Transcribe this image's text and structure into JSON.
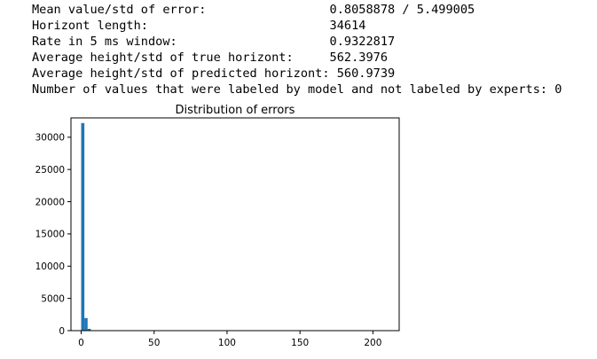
{
  "output_lines": [
    "Mean value/std of error:                 0.8058878 / 5.499005",
    "Horizont length:                         34614",
    "Rate in 5 ms window:                     0.9322817",
    "Average height/std of true horizont:     562.3976",
    "Average height/std of predicted horizont: 560.9739",
    "Number of values that were labeled by model and not labeled by experts: 0"
  ],
  "chart_data": {
    "type": "bar",
    "title": "Distribution of errors",
    "xlabel": "",
    "ylabel": "",
    "xlim": [
      -7,
      218
    ],
    "ylim": [
      0,
      33000
    ],
    "bar_width": 2.2,
    "bins": [
      {
        "x": 1.1,
        "value": 32200
      },
      {
        "x": 3.3,
        "value": 1950
      },
      {
        "x": 5.5,
        "value": 280
      },
      {
        "x": 7.7,
        "value": 60
      }
    ],
    "x_ticks": [
      0,
      50,
      100,
      150,
      200
    ],
    "y_ticks": [
      0,
      5000,
      10000,
      15000,
      20000,
      25000,
      30000
    ],
    "x_tick_labels": [
      "0",
      "50",
      "100",
      "150",
      "200"
    ],
    "y_tick_labels": [
      "0",
      "5000",
      "10000",
      "15000",
      "20000",
      "25000",
      "30000"
    ],
    "bar_color": "#1f77b4",
    "grid": false
  }
}
